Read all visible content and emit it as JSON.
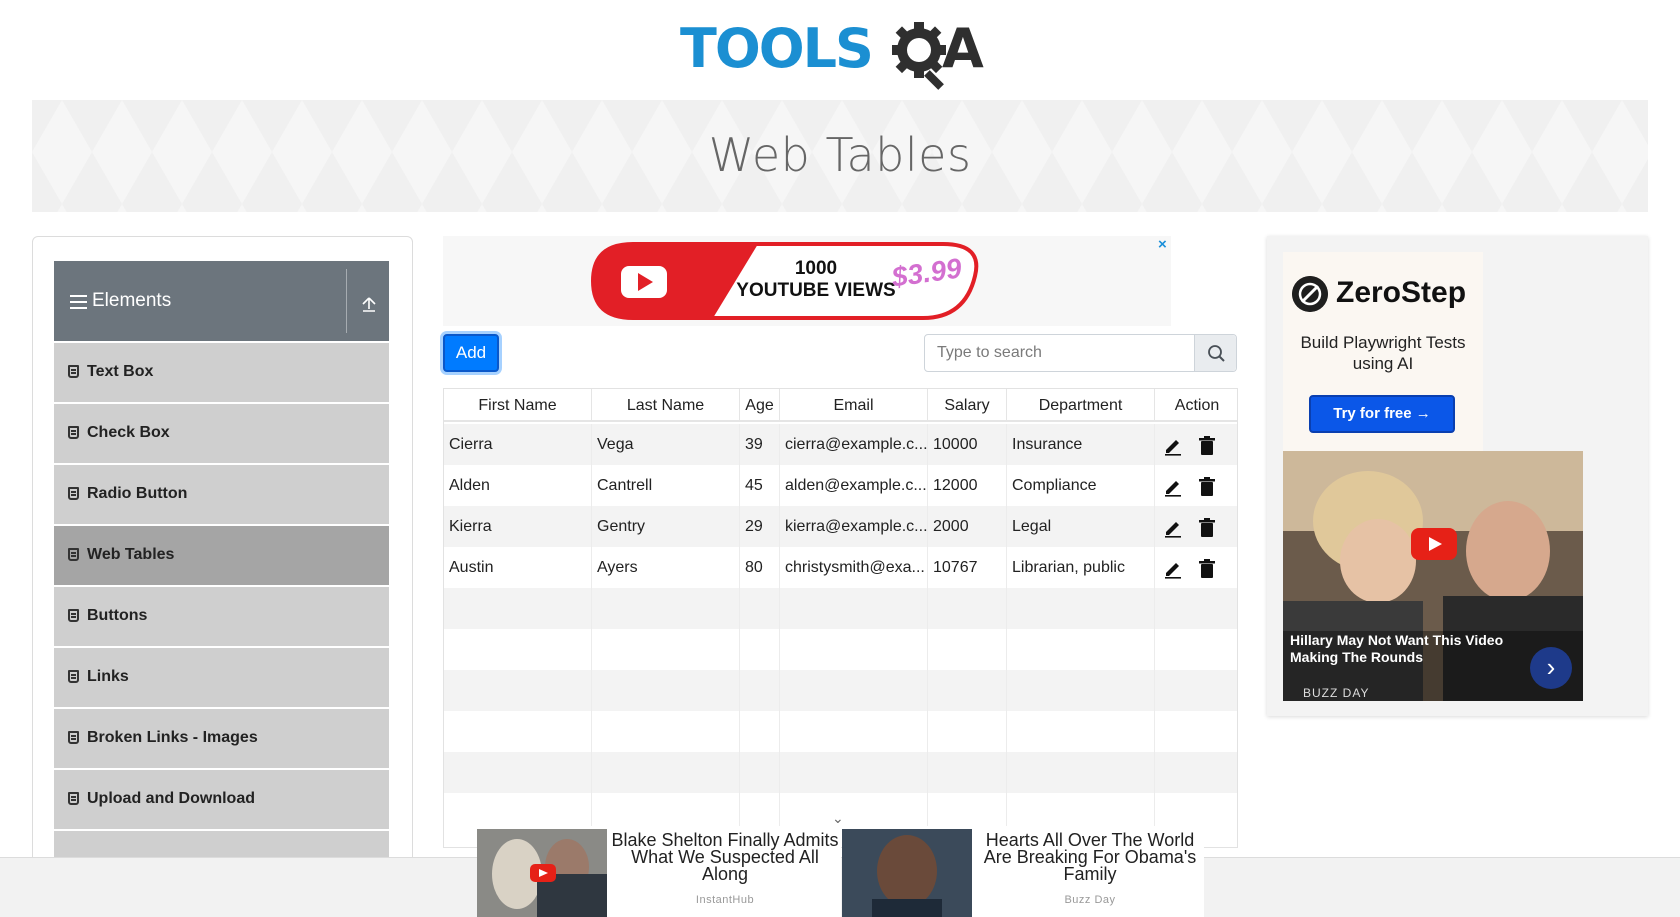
{
  "logo": {
    "text_left": "TOOLS",
    "text_right": "QA"
  },
  "banner": {
    "title": "Web Tables"
  },
  "sidebar": {
    "group_title": "Elements",
    "items": [
      {
        "label": "Text Box",
        "active": false
      },
      {
        "label": "Check Box",
        "active": false
      },
      {
        "label": "Radio Button",
        "active": false
      },
      {
        "label": "Web Tables",
        "active": true
      },
      {
        "label": "Buttons",
        "active": false
      },
      {
        "label": "Links",
        "active": false
      },
      {
        "label": "Broken Links - Images",
        "active": false
      },
      {
        "label": "Upload and Download",
        "active": false
      }
    ]
  },
  "ad_top": {
    "line1": "1000",
    "line2": "YOUTUBE VIEWS",
    "price": "$3.99",
    "close": "×"
  },
  "toolbar": {
    "add_label": "Add",
    "search_placeholder": "Type to search"
  },
  "table": {
    "headers": [
      "First Name",
      "Last Name",
      "Age",
      "Email",
      "Salary",
      "Department",
      "Action"
    ],
    "rows": [
      [
        "Cierra",
        "Vega",
        "39",
        "cierra@example.c...",
        "10000",
        "Insurance"
      ],
      [
        "Alden",
        "Cantrell",
        "45",
        "alden@example.c...",
        "12000",
        "Compliance"
      ],
      [
        "Kierra",
        "Gentry",
        "29",
        "kierra@example.c...",
        "2000",
        "Legal"
      ],
      [
        "Austin",
        "Ayers",
        "80",
        "christysmith@exa...",
        "10767",
        "Librarian, public"
      ]
    ]
  },
  "ad_right": {
    "brand": "ZeroStep",
    "tagline": "Build Playwright Tests using AI",
    "cta": "Try for free →",
    "photo_caption": "Hillary May Not Want This Video Making The Rounds",
    "photo_source": "BUZZ DAY"
  },
  "bottom_ads": [
    {
      "title": "Blake Shelton Finally Admits What We Suspected All Along",
      "source": "InstantHub"
    },
    {
      "title": "Hearts All Over The World Are Breaking For Obama's Family",
      "source": "Buzz Day"
    }
  ]
}
